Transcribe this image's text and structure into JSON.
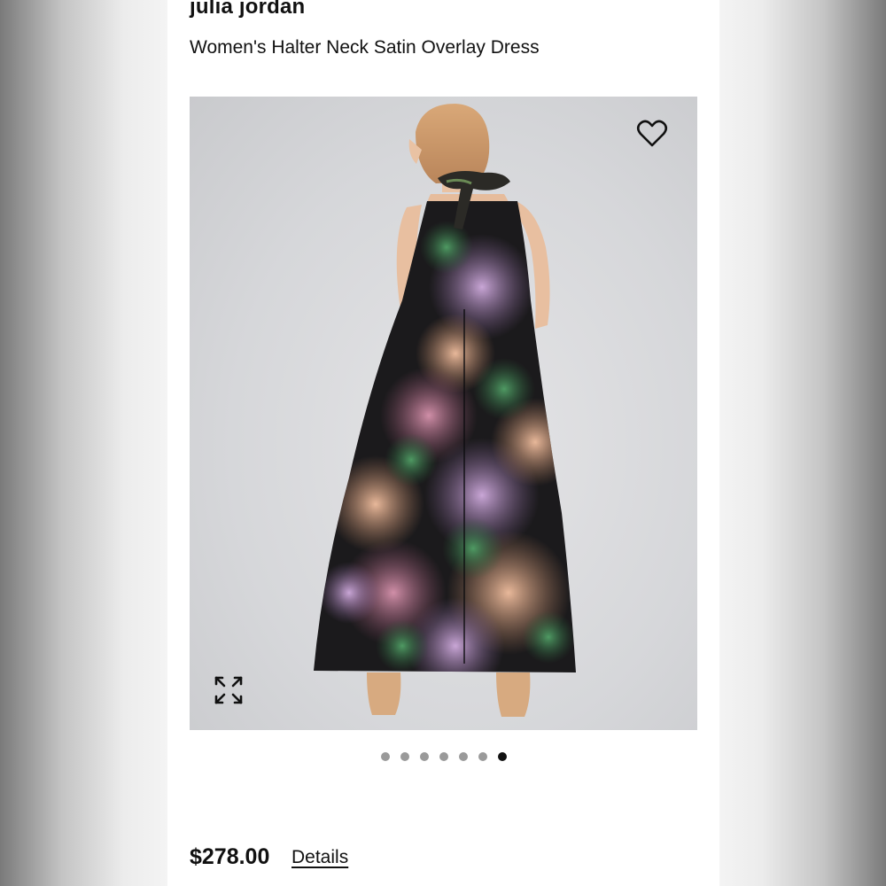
{
  "product": {
    "brand": "julia jordan",
    "title": "Women's Halter Neck Satin Overlay Dress",
    "price": "$278.00",
    "details_label": "Details"
  },
  "gallery": {
    "image_count": 7,
    "active_index": 6,
    "favorite_icon": "heart-outline-icon",
    "expand_icon": "expand-arrows-icon"
  },
  "colors": {
    "text": "#111111",
    "dot_inactive": "#9a9a9a",
    "dot_active": "#111111"
  }
}
